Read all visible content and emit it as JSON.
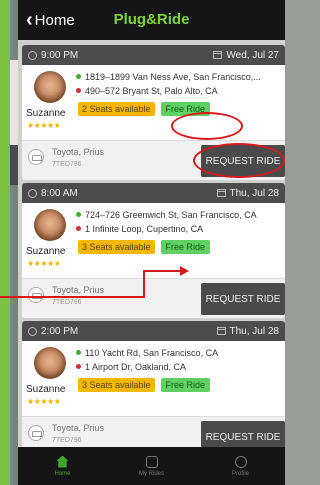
{
  "nav": {
    "back_label": "Home",
    "title": "Plug&Ride"
  },
  "rides": [
    {
      "time": "9:00 PM",
      "date": "Wed, Jul 27",
      "from": "1819–1899 Van Ness Ave, San Francisco,...",
      "to": "490–572 Bryant St, Palo Alto, CA",
      "driver": "Suzanne",
      "rating_stars": "★★★★★",
      "seats": "2 Seats available",
      "price": "Free Ride",
      "car": "Toyota, Prius",
      "plate": "7TED796",
      "action": "REQUEST RIDE"
    },
    {
      "time": "8:00 AM",
      "date": "Thu, Jul 28",
      "from": "724–726 Greenwich St, San Francisco, CA",
      "to": "1 Infinite Loop, Cupertino, CA",
      "driver": "Suzanne",
      "rating_stars": "★★★★★",
      "seats": "3 Seats available",
      "price": "Free Ride",
      "car": "Toyota, Prius",
      "plate": "7TED796",
      "action": "REQUEST RIDE"
    },
    {
      "time": "2:00 PM",
      "date": "Thu, Jul 28",
      "from": "110 Yacht Rd, San Francisco, CA",
      "to": "1 Airport Dr, Oakland, CA",
      "driver": "Suzanne",
      "rating_stars": "★★★★★",
      "seats": "3 Seats available",
      "price": "Free Ride",
      "car": "Toyota, Prius",
      "plate": "7TED796",
      "action": "REQUEST RIDE"
    }
  ],
  "tabs": {
    "home": "Home",
    "my_rides": "My Rides",
    "profile": "Profile"
  },
  "colors": {
    "brand_green": "#7dd33b",
    "annotation_red": "#d7191c",
    "seats_badge": "#f5b800",
    "free_badge": "#5fd164"
  }
}
